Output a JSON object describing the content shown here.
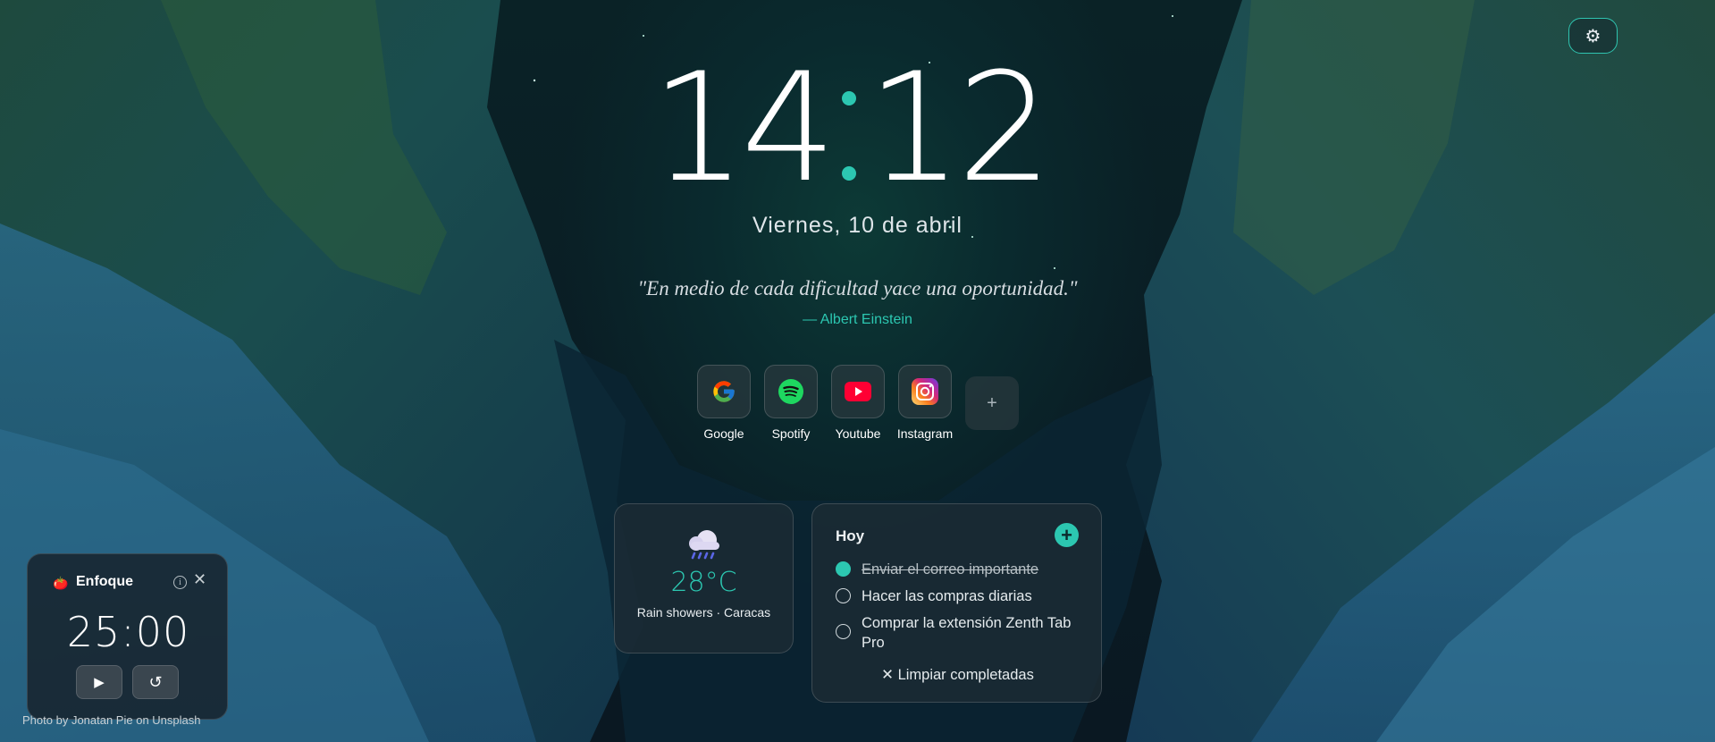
{
  "settings": {
    "icon": "gear-icon"
  },
  "clock": {
    "hours": "14",
    "minutes": "12"
  },
  "date": "Viernes, 10 de abril",
  "quote": {
    "text": "\"En medio de cada dificultad yace una oportunidad.\"",
    "author": "— Albert Einstein"
  },
  "shortcuts": [
    {
      "label": "Google",
      "icon": "google-icon"
    },
    {
      "label": "Spotify",
      "icon": "spotify-icon"
    },
    {
      "label": "Youtube",
      "icon": "youtube-icon"
    },
    {
      "label": "Instagram",
      "icon": "instagram-icon"
    }
  ],
  "add_shortcut": {
    "label": "+"
  },
  "weather": {
    "icon": "rain-cloud-icon",
    "temperature": "28°C",
    "description": "Rain showers · Caracas"
  },
  "todo": {
    "title": "Hoy",
    "add_label": "+",
    "items": [
      {
        "text": "Enviar el correo importante",
        "done": true
      },
      {
        "text": "Hacer las compras diarias",
        "done": false
      },
      {
        "text": "Comprar la extensión Zenth Tab Pro",
        "done": false
      }
    ],
    "clear_label": "✕ Limpiar completadas"
  },
  "focus": {
    "title": "Enfoque",
    "time": "25:00",
    "play_label": "▶",
    "reset_label": "↺",
    "close_label": "✕",
    "info_label": "i"
  },
  "credit": {
    "prefix": "Photo by ",
    "author": "Jonatan Pie",
    "middle": " on ",
    "source": "Unsplash"
  },
  "colors": {
    "accent": "#2cc7b1",
    "card_bg": "#1e2c34"
  }
}
